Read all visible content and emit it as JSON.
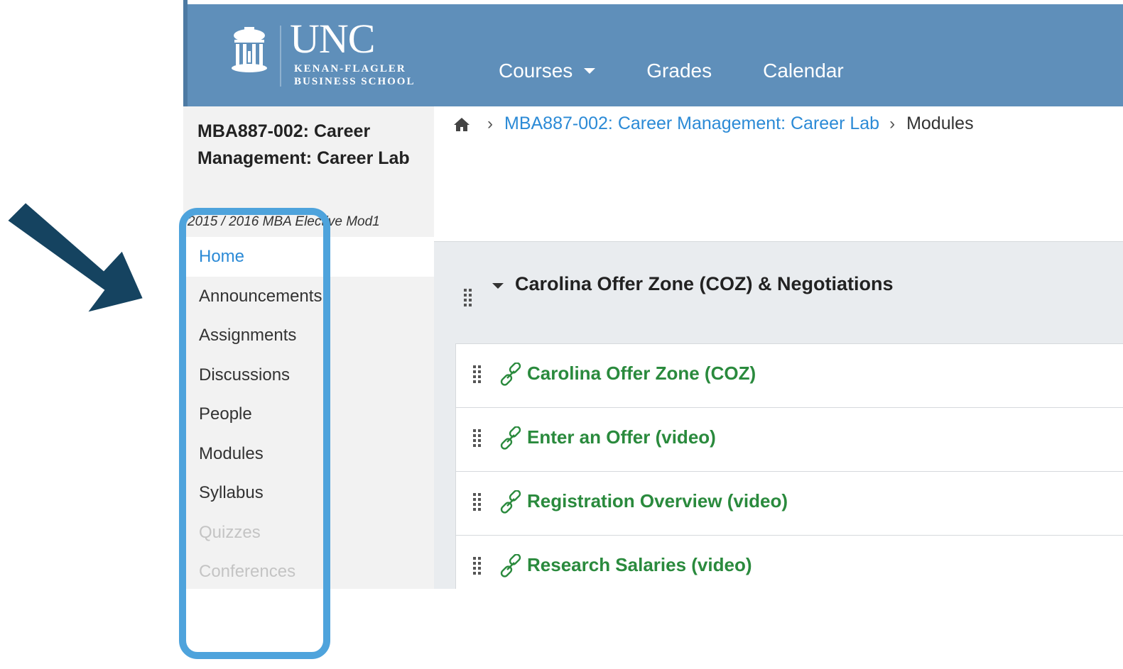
{
  "header": {
    "logo": {
      "name": "UNC",
      "school_line1": "KENAN-FLAGLER",
      "school_line2": "BUSINESS SCHOOL"
    },
    "nav": [
      {
        "label": "Courses",
        "has_dropdown": true
      },
      {
        "label": "Grades"
      },
      {
        "label": "Calendar"
      }
    ],
    "bg_color": "#5f8fba"
  },
  "sidebar": {
    "course_title": "MBA887-002: Career Management: Career Lab",
    "term": "2015 / 2016 MBA Elective Mod1",
    "items": [
      {
        "label": "Home",
        "state": "active"
      },
      {
        "label": "Announcements"
      },
      {
        "label": "Assignments"
      },
      {
        "label": "Discussions"
      },
      {
        "label": "People"
      },
      {
        "label": "Modules"
      },
      {
        "label": "Syllabus"
      },
      {
        "label": "Quizzes",
        "state": "disabled"
      },
      {
        "label": "Conferences",
        "state": "disabled"
      }
    ]
  },
  "breadcrumb": {
    "home_icon": "home-icon",
    "course_link": "MBA887-002: Career Management: Career Lab",
    "current": "Modules"
  },
  "module": {
    "title": "Carolina Offer Zone (COZ) & Negotiations",
    "items": [
      {
        "title": "Carolina Offer Zone (COZ)",
        "icon": "link-icon"
      },
      {
        "title": "Enter an Offer (video)",
        "icon": "link-icon"
      },
      {
        "title": "Registration Overview (video)",
        "icon": "link-icon"
      },
      {
        "title": "Research Salaries (video)",
        "icon": "link-icon"
      }
    ]
  },
  "annotation": {
    "arrow_color": "#154360",
    "highlight_color": "#4ea3dc"
  },
  "colors": {
    "link_blue": "#2b8ad6",
    "item_green": "#2a8a3d"
  }
}
